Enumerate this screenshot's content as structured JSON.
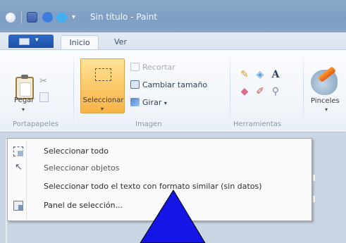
{
  "window": {
    "title": "Sin título - Paint"
  },
  "qat": {
    "dropdown_glyph": "▾"
  },
  "tabs": {
    "file_arrow": "▾",
    "items": [
      {
        "label": "Inicio"
      },
      {
        "label": "Ver"
      }
    ]
  },
  "ribbon": {
    "clipboard": {
      "paste_label": "Pegar",
      "group_label": "Portapapeles"
    },
    "image": {
      "select_label": "Seleccionar",
      "crop_label": "Recortar",
      "resize_label": "Cambiar tamaño",
      "rotate_label": "Girar",
      "dropdown_glyph": "▾",
      "group_label": "Imagen"
    },
    "tools": {
      "group_label": "Herramientas",
      "text_glyph": "A"
    },
    "brushes": {
      "label": "Pinceles"
    }
  },
  "menu": {
    "items": [
      {
        "label": "Seleccionar todo",
        "icon": "select-all-icon"
      },
      {
        "label": "Seleccionar objetos",
        "icon": "select-objects-icon"
      },
      {
        "label": "Seleccionar todo el texto con formato similar (sin datos)",
        "icon": "none"
      },
      {
        "label": "Panel de selección...",
        "icon": "selection-pane-icon"
      }
    ]
  },
  "colors": {
    "title_bar": "#7e9ec3",
    "file_menu": "#2563b8",
    "select_highlight": "#fcc96a",
    "annotation_arrow": "#1515e6"
  }
}
